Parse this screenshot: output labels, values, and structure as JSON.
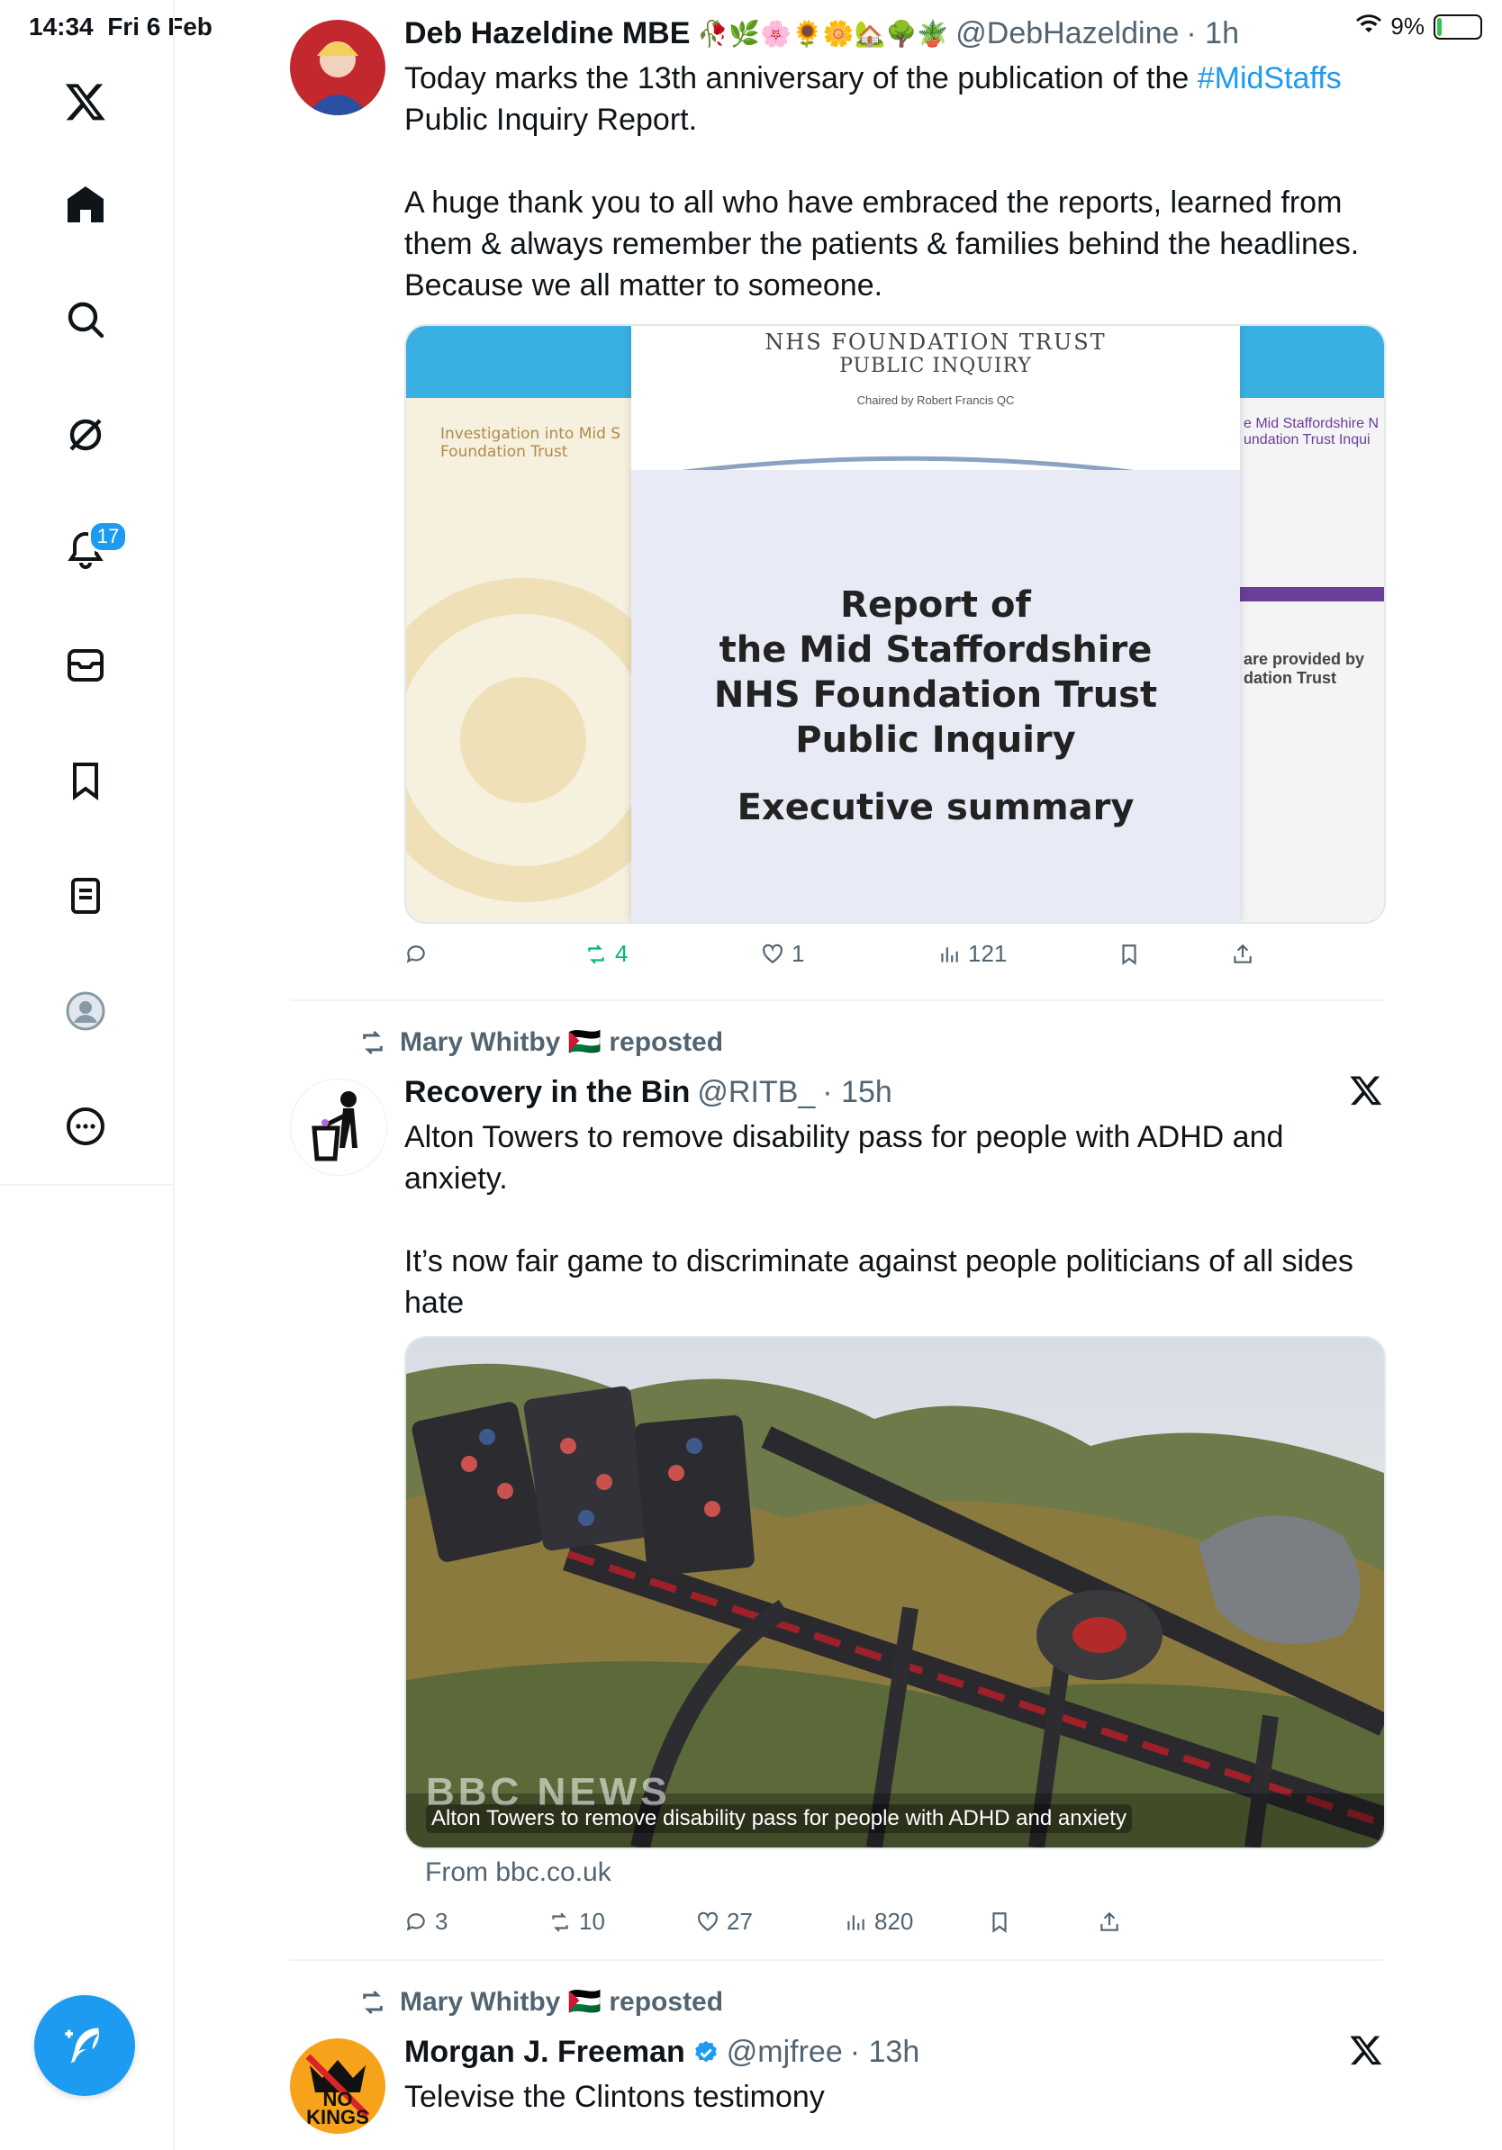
{
  "status_bar": {
    "time": "14:34",
    "date": "Fri 6 Feb",
    "battery": "9%"
  },
  "sidebar": {
    "notifications_badge": "17"
  },
  "tweets": [
    {
      "name": "Deb Hazeldine MBE",
      "emojis": "🥀🌿🌸🌻🌼🏡🌳🪴",
      "handle": "@DebHazeldine",
      "time": "· 1h",
      "text_part1": "Today marks the 13th anniversary of the publication of the ",
      "hashtag": "#MidStaffs",
      "text_part2": "\nPublic Inquiry Report.\n\nA huge thank you to all who have embraced the reports, learned from them & always remember the patients & families behind the headlines. Because we all matter to someone.",
      "media": {
        "trust_name": "NHS FOUNDATION TRUST",
        "inquiry": "PUBLIC INQUIRY",
        "chaired": "Chaired by Robert Francis QC",
        "left_cover": "Investigation into Mid S\nFoundation Trust",
        "right_cover_top": "e Mid Staffordshire N\nundation Trust Inqui",
        "right_cover_bottom": "are provided by\ndation Trust",
        "report_title": "Report of\nthe Mid Staffordshire\nNHS Foundation Trust\nPublic Inquiry",
        "exec": "Executive summary"
      },
      "actions": {
        "replies": "",
        "reposts": "4",
        "likes": "1",
        "views": "121"
      }
    },
    {
      "reposted_by": "Mary Whitby 🇵🇸 reposted",
      "name": "Recovery in the Bin",
      "handle": "@RITB_",
      "time": "· 15h",
      "text": "Alton Towers to remove disability pass for people with ADHD and anxiety.\n\nIt’s now fair game to discriminate against people politicians of all sides hate",
      "card_caption": "Alton Towers to remove disability pass for people with ADHD and anxiety",
      "card_watermark": "BBC NEWS",
      "source": "From bbc.co.uk",
      "actions": {
        "replies": "3",
        "reposts": "10",
        "likes": "27",
        "views": "820"
      }
    },
    {
      "reposted_by": "Mary Whitby 🇵🇸 reposted",
      "name": "Morgan J. Freeman",
      "handle": "@mjfree",
      "time": "· 13h",
      "text": "Televise the Clintons testimony",
      "avatar_text": "NO\nKINGS"
    }
  ]
}
